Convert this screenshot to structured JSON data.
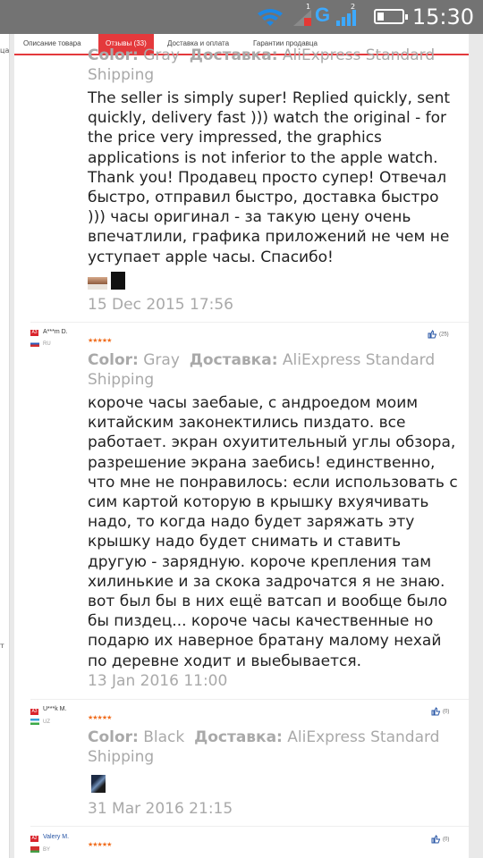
{
  "status_bar": {
    "time": "15:30",
    "sim1": "1",
    "sim2": "2",
    "network": "G"
  },
  "tabs": [
    {
      "label": "Описание товара"
    },
    {
      "label": "Отзывы (33)",
      "active": true
    },
    {
      "label": "Доставка и оплата"
    },
    {
      "label": "Гарантии продавца"
    }
  ],
  "left_fragments": [
    "ца",
    "т"
  ],
  "reviews": [
    {
      "attr_color_label": "Color:",
      "attr_color_value": "Gray",
      "attr_ship_label": "Доставка:",
      "attr_ship_value": "AliExpress Standard Shipping",
      "text": "The seller is simply super! Replied quickly, sent quickly, delivery fast ))) watch the original - for the price very impressed, the graphics applications is not inferior to the apple watch. Thank you! Продавец просто супер! Отвечал быстро, отправил быстро, доставка быстро ))) часы оригинал - за такую цену очень впечатлили, графика приложений не чем не уступает apple часы. Спасибо!",
      "date": "15 Dec 2015 17:56",
      "photos": [
        "photo-1",
        "photo-2"
      ]
    },
    {
      "badge": "A3",
      "user": "A***m D.",
      "country": "RU",
      "stars": "★★★★★",
      "likes": "(25)",
      "attr_color_label": "Color:",
      "attr_color_value": "Gray",
      "attr_ship_label": "Доставка:",
      "attr_ship_value": "AliExpress Standard Shipping",
      "text": "короче часы заебаые, с андроедом моим китайским законектились пиздато. все работает. экран охуитительный углы обзора, разрешение экрана заебись! единственно, что мне не понравилось: если использовать с сим картой которую в крышку вхуячивать надо, то когда надо будет заряжать эту крышку надо будет снимать и ставить другую - зарядную. короче крепления там хилинькие и за скока задрочатся я не знаю. вот был бы в них ещё ватсап и вообще было бы пиздец... короче часы качественные но подарю их наверное братану малому нехай по деревне ходит и выебывается.",
      "date": "13 Jan 2016 11:00"
    },
    {
      "badge": "A3",
      "user": "U***k M.",
      "country": "UZ",
      "stars": "★★★★★",
      "likes": "(0)",
      "attr_color_label": "Color:",
      "attr_color_value": "Black",
      "attr_ship_label": "Доставка:",
      "attr_ship_value": "AliExpress Standard Shipping",
      "date": "31 Mar 2016 21:15",
      "photos": [
        "photo-1"
      ]
    },
    {
      "badge": "A2",
      "user": "Valery M.",
      "country": "BY",
      "stars": "★★★★★",
      "likes": "(0)"
    }
  ],
  "colors": {
    "accent": "#e4393c",
    "star": "#f06d1e",
    "status_bar": "#737373",
    "muted_text": "#a9a9a9"
  }
}
